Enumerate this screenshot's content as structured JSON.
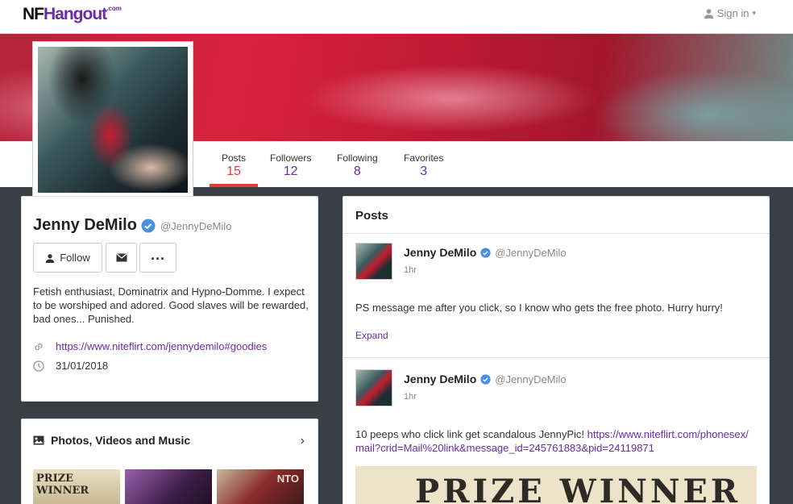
{
  "header": {
    "logo_prefix": "NF",
    "logo_main": "Hangout",
    "logo_suffix": ".com",
    "signin_label": "Sign in"
  },
  "stats": [
    {
      "label": "Posts",
      "value": "15"
    },
    {
      "label": "Followers",
      "value": "12"
    },
    {
      "label": "Following",
      "value": "8"
    },
    {
      "label": "Favorites",
      "value": "3"
    }
  ],
  "profile": {
    "name": "Jenny DeMilo",
    "handle": "@JennyDeMilo",
    "follow_label": "Follow",
    "bio": "Fetish enthusiast, Dominatrix and Hypno-Domme. I expect to be worshiped and adored. Good slaves will be rewarded, bad ones... Punished.",
    "link": "https://www.niteflirt.com/jennydemilo#goodies",
    "date": "31/01/2018"
  },
  "media": {
    "title": "Photos, Videos and Music",
    "thumb_texts": [
      "PRIZE WINNER",
      "",
      "NTO"
    ]
  },
  "posts_panel": {
    "title": "Posts",
    "posts": [
      {
        "name": "Jenny DeMilo",
        "handle": "@JennyDeMilo",
        "time": "1hr",
        "text": "PS message me after you click, so I know who gets the free photo. Hurry hurry!",
        "expand_label": "Expand"
      },
      {
        "name": "Jenny DeMilo",
        "handle": "@JennyDeMilo",
        "time": "1hr",
        "text": "10 peeps who click link get scandalous JennyPic! ",
        "link": "https://www.niteflirt.com/phonesex/mail?crid=Mail%20link&message_id=245761883&pid=24119871",
        "image_text": "PRIZE WINNER"
      }
    ]
  },
  "colors": {
    "accent": "#6b2aa8",
    "active_tab": "#e0412e",
    "background": "#3a3f46"
  }
}
